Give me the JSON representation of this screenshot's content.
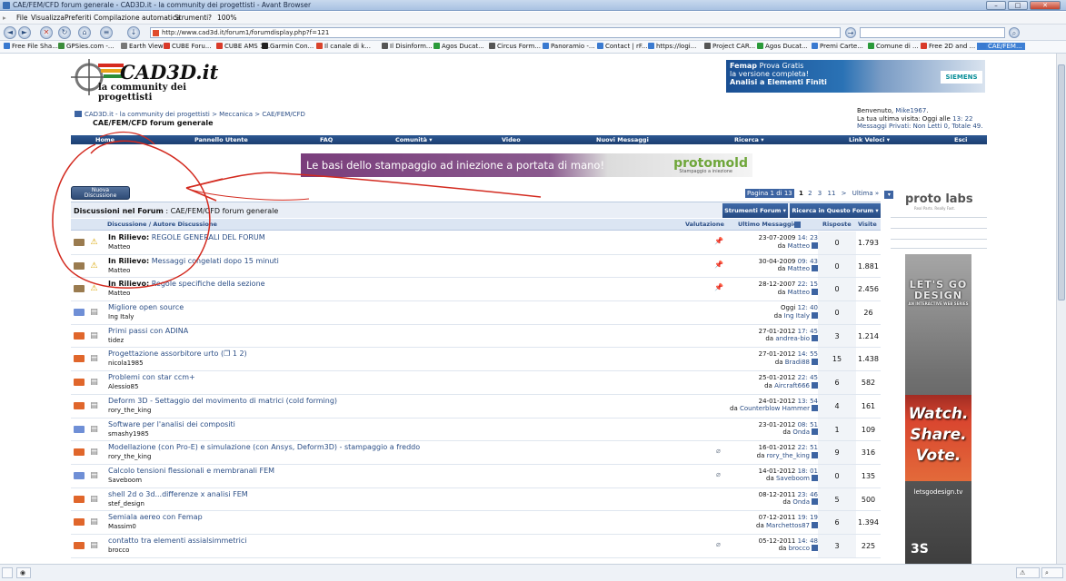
{
  "window": {
    "title": "CAE/FEM/CFD forum generale - CAD3D.it - la community dei progettisti - Avant Browser"
  },
  "menu": [
    "File",
    "Visualizza",
    "Preferiti",
    "Compilazione automatica",
    "Strumenti",
    "?",
    "100%"
  ],
  "address": {
    "url": "http://www.cad3d.it/forum1/forumdisplay.php?f=121"
  },
  "favorites": [
    {
      "label": "Free File Sha...",
      "color": "#3a7ad0"
    },
    {
      "label": "GPSies.com -...",
      "color": "#3b8d3b"
    },
    {
      "label": "Earth View",
      "color": "#777"
    },
    {
      "label": "CUBE Foru...",
      "color": "#d93a2a"
    },
    {
      "label": "CUBE AMS 1...",
      "color": "#d93a2a"
    },
    {
      "label": "Garmin Con...",
      "color": "#222"
    },
    {
      "label": "Il canale di k...",
      "color": "#d9432b"
    },
    {
      "label": "Il Disinform...",
      "color": "#555"
    },
    {
      "label": "Agos Ducat...",
      "color": "#2a9a3a"
    },
    {
      "label": "Circus Form...",
      "color": "#555"
    },
    {
      "label": "Panoramio -...",
      "color": "#3a7ad0"
    },
    {
      "label": "Contact | rF...",
      "color": "#3a7ad0"
    },
    {
      "label": "https://logi...",
      "color": "#3a7ad0"
    },
    {
      "label": "Project CAR...",
      "color": "#555"
    },
    {
      "label": "Agos Ducat...",
      "color": "#2a9a3a"
    },
    {
      "label": "Premi Carte...",
      "color": "#3a7ad0"
    },
    {
      "label": "Comune di ...",
      "color": "#2a9a3a"
    },
    {
      "label": "Free 2D and ...",
      "color": "#d93a2a"
    },
    {
      "label": "CAE/FEM...",
      "color": "#3a7ad0"
    }
  ],
  "site": {
    "logo_name": "CAD3D.it",
    "logo_tag": "la community dei progettisti"
  },
  "ad_top": {
    "line1_bold": "Femap",
    "line1": "Prova Gratis",
    "line2": "la versione completa!",
    "line3": "Analisi a Elementi Finiti",
    "brand": "SIEMENS"
  },
  "breadcrumb": {
    "path": "CAD3D.it - la community dei progettisti > Meccanica > CAE/FEM/CFD",
    "title": "CAE/FEM/CFD forum generale"
  },
  "welcome": {
    "line1_prefix": "Benvenuto,",
    "user": "Mike1967",
    "line2_prefix": "La tua ultima visita: Oggi alle",
    "line2_time": "13: 22",
    "line3": "Messaggi Privati: Non Letti 0, Totale 49."
  },
  "mainnav": [
    "Home",
    "Pannello Utente",
    "FAQ",
    "Comunità ▾",
    "Video",
    "Nuovi Messaggi",
    "Ricerca ▾",
    "Link Veloci ▾",
    "Esci"
  ],
  "banner": {
    "text": "Le basi dello stampaggio ad iniezione a portata di mano!",
    "brand": "protomold",
    "brand_sub": "Stampaggio a iniezione"
  },
  "new_discussion": {
    "line1": "Nuova",
    "line2": "Discussione"
  },
  "pager": {
    "label": "Pagina 1 di 13",
    "current": "1",
    "pages": [
      "2",
      "3",
      "11",
      ">",
      "Ultima »"
    ]
  },
  "forum_header": {
    "prefix": "Discussioni nel Forum",
    "name": ": CAE/FEM/CFD forum generale",
    "tools": "Strumenti Forum ▾",
    "search": "Ricerca in Questo Forum ▾"
  },
  "columns": {
    "title": "Discussione / Autore Discussione",
    "rating": "Valutazione",
    "last": "Ultimo Messaggio",
    "replies": "Risposte",
    "views": "Visite"
  },
  "threads": [
    {
      "sticky": "In Rilievo:",
      "title": "REGOLE GENERALI DEL FORUM",
      "author": "Matteo",
      "date": "23-07-2009",
      "time": "14: 23",
      "by": "Matteo",
      "replies": "0",
      "views": "1.793",
      "pinned": true,
      "attach": false,
      "type": "sticky"
    },
    {
      "sticky": "In Rilievo:",
      "title": "Messaggi congelati dopo 15 minuti",
      "author": "Matteo",
      "date": "30-04-2009",
      "time": "09: 43",
      "by": "Matteo",
      "replies": "0",
      "views": "1.881",
      "pinned": true,
      "attach": false,
      "type": "sticky"
    },
    {
      "sticky": "In Rilievo:",
      "title": "Regole specifiche della sezione",
      "author": "Matteo",
      "date": "28-12-2007",
      "time": "22: 15",
      "by": "Matteo",
      "replies": "0",
      "views": "2.456",
      "pinned": true,
      "attach": false,
      "type": "sticky"
    },
    {
      "sticky": "",
      "title": "Migliore open source",
      "author": "Ing Italy",
      "date": "Oggi",
      "time": "12: 40",
      "by": "Ing Italy",
      "replies": "0",
      "views": "26",
      "pinned": false,
      "attach": false,
      "type": "new"
    },
    {
      "sticky": "",
      "title": "Primi passi con ADINA",
      "author": "tidez",
      "date": "27-01-2012",
      "time": "17: 45",
      "by": "andrea-bio",
      "replies": "3",
      "views": "1.214",
      "pinned": false,
      "attach": false,
      "type": "hot"
    },
    {
      "sticky": "",
      "title": "Progettazione assorbitore urto (❐ 1 2)",
      "author": "nicola1985",
      "date": "27-01-2012",
      "time": "14: 55",
      "by": "Bradi88",
      "replies": "15",
      "views": "1.438",
      "pinned": false,
      "attach": false,
      "type": "hot"
    },
    {
      "sticky": "",
      "title": "Problemi con star ccm+",
      "author": "Alessio85",
      "date": "25-01-2012",
      "time": "22: 45",
      "by": "Aircraft666",
      "replies": "6",
      "views": "582",
      "pinned": false,
      "attach": false,
      "type": "hot"
    },
    {
      "sticky": "",
      "title": "Deform 3D - Settaggio del movimento di matrici (cold forming)",
      "author": "rory_the_king",
      "date": "24-01-2012",
      "time": "13: 54",
      "by": "Counterblow Hammer",
      "replies": "4",
      "views": "161",
      "pinned": false,
      "attach": false,
      "type": "hot"
    },
    {
      "sticky": "",
      "title": "Software per l'analisi dei compositi",
      "author": "smashy1985",
      "date": "23-01-2012",
      "time": "08: 51",
      "by": "Onda",
      "replies": "1",
      "views": "109",
      "pinned": false,
      "attach": false,
      "type": "new"
    },
    {
      "sticky": "",
      "title": "Modellazione (con Pro-E) e simulazione (con Ansys, Deform3D) - stampaggio a freddo",
      "author": "rory_the_king",
      "date": "16-01-2012",
      "time": "22: 51",
      "by": "rory_the_king",
      "replies": "9",
      "views": "316",
      "pinned": false,
      "attach": true,
      "type": "hot"
    },
    {
      "sticky": "",
      "title": "Calcolo tensioni flessionali e membranali FEM",
      "author": "Saveboom",
      "date": "14-01-2012",
      "time": "18: 01",
      "by": "Saveboom",
      "replies": "0",
      "views": "135",
      "pinned": false,
      "attach": true,
      "type": "new"
    },
    {
      "sticky": "",
      "title": "shell 2d o 3d...differenze x analisi FEM",
      "author": "stef_design",
      "date": "08-12-2011",
      "time": "23: 46",
      "by": "Onda",
      "replies": "5",
      "views": "500",
      "pinned": false,
      "attach": false,
      "type": "hot"
    },
    {
      "sticky": "",
      "title": "Semiala aereo con Femap",
      "author": "Massim0",
      "date": "07-12-2011",
      "time": "19: 19",
      "by": "Marchettos87",
      "replies": "6",
      "views": "1.394",
      "pinned": false,
      "attach": false,
      "type": "hot"
    },
    {
      "sticky": "",
      "title": "contatto tra elementi assialsimmetrici",
      "author": "brocco",
      "date": "05-12-2011",
      "time": "14: 48",
      "by": "brocco",
      "replies": "3",
      "views": "225",
      "pinned": false,
      "attach": true,
      "type": "hot"
    }
  ],
  "right_ads": {
    "protolabs": "proto labs",
    "protolabs_sub": "Real Parts. Really Fast.",
    "lets": "LET'S GO DESIGN",
    "lets_sub": "AN INTERACTIVE WEB SERIES",
    "watch": "Watch.",
    "share": "Share.",
    "vote": "Vote.",
    "url": "letsgodesign.tv",
    "ds": "3S"
  }
}
